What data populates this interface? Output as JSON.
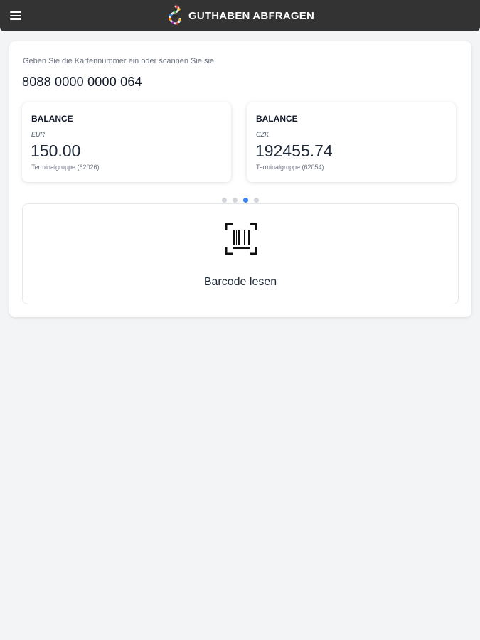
{
  "header": {
    "title": "GUTHABEN ABFRAGEN",
    "menu_icon": "hamburger-menu-icon",
    "logo_icon": "brand-logo-icon",
    "background": "#333333"
  },
  "card_input": {
    "prompt": "Geben Sie die Kartennummer ein oder scannen Sie sie",
    "value": "8088 0000 0000 064"
  },
  "balances": [
    {
      "title": "BALANCE",
      "currency": "EUR",
      "amount": "150.00",
      "group": "Terminalgruppe (62026)"
    },
    {
      "title": "BALANCE",
      "currency": "CZK",
      "amount": "192455.74",
      "group": "Terminalgruppe (62054)"
    }
  ],
  "pagination": {
    "total": 4,
    "active_index": 3,
    "active_color": "#3b82f6"
  },
  "scan": {
    "label": "Barcode lesen",
    "icon": "barcode-scan-icon"
  }
}
